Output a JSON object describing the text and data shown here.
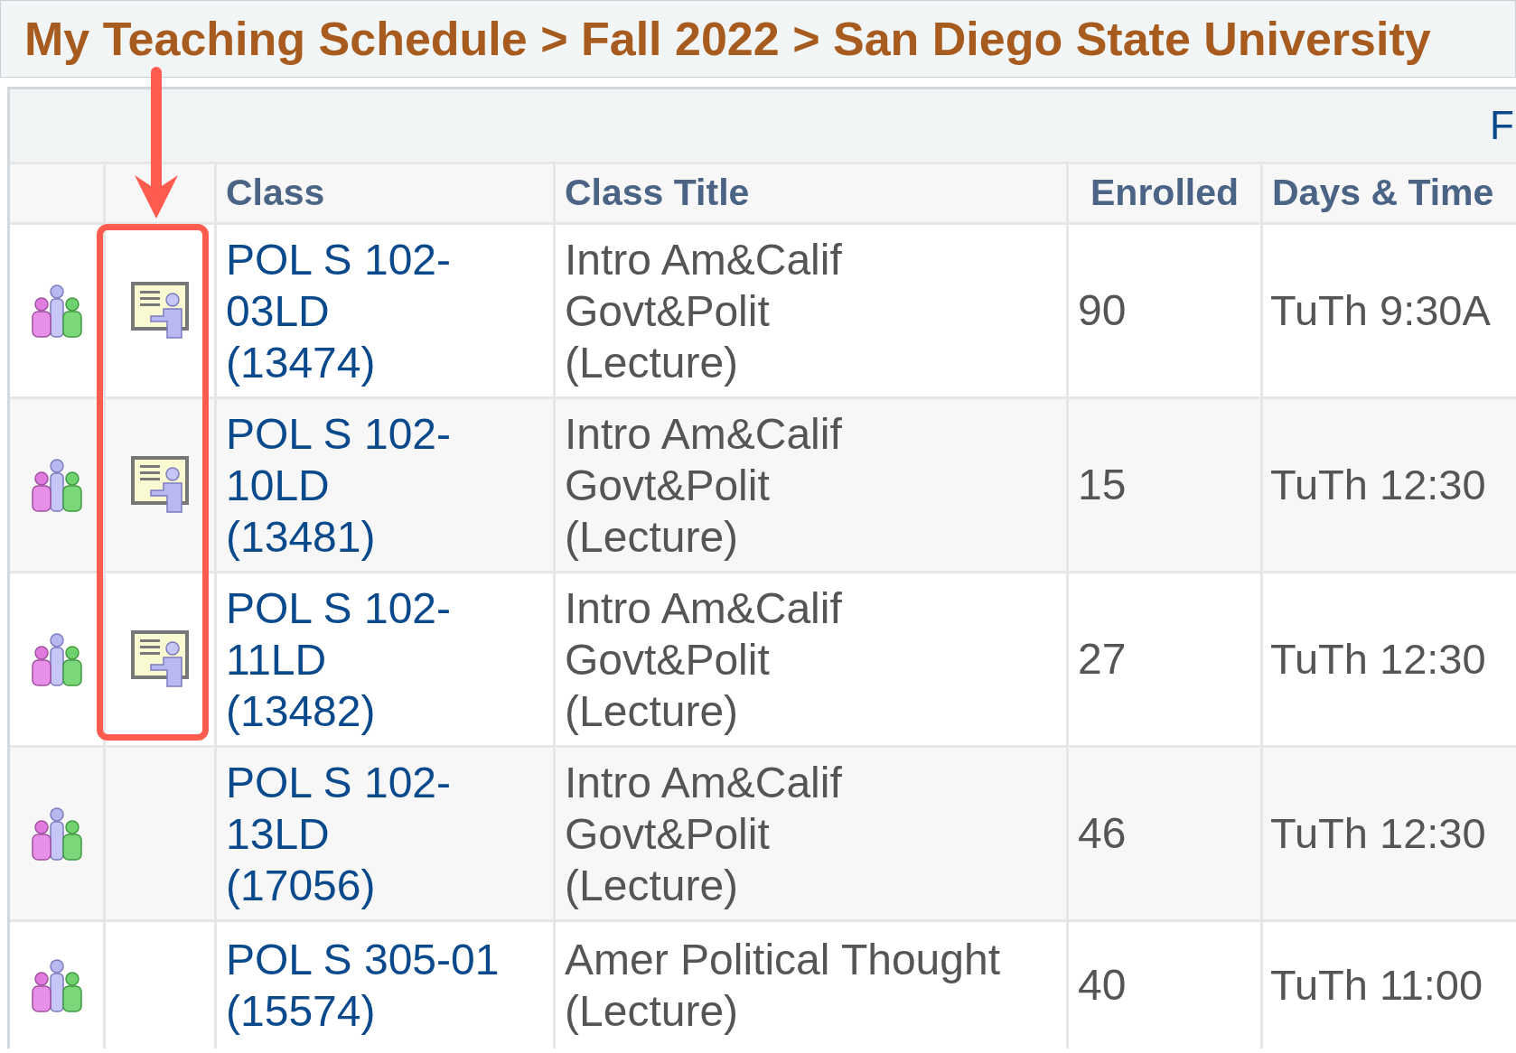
{
  "title": "My Teaching Schedule > Fall 2022 > San Diego State University",
  "toolbar": {
    "link": "F"
  },
  "table": {
    "columns": [
      "Class",
      "Class Title",
      "Enrolled",
      "Days & Time"
    ],
    "rows": [
      {
        "class": "POL S 102-03LD",
        "class_number": "(13474)",
        "title": "Intro Am&Calif Govt&Polit",
        "component": "(Lecture)",
        "enrolled": "90",
        "days_times": "TuTh 9:30A",
        "teaching_icon": true
      },
      {
        "class": "POL S 102-10LD",
        "class_number": "(13481)",
        "title": "Intro Am&Calif Govt&Polit",
        "component": "(Lecture)",
        "enrolled": "15",
        "days_times": "TuTh 12:30",
        "teaching_icon": true
      },
      {
        "class": "POL S 102-11LD",
        "class_number": "(13482)",
        "title": "Intro Am&Calif Govt&Polit",
        "component": "(Lecture)",
        "enrolled": "27",
        "days_times": "TuTh 12:30",
        "teaching_icon": true
      },
      {
        "class": "POL S 102-13LD",
        "class_number": "(17056)",
        "title": "Intro Am&Calif Govt&Polit",
        "component": "(Lecture)",
        "enrolled": "46",
        "days_times": "TuTh 12:30",
        "teaching_icon": false
      },
      {
        "class": "POL S 305-01",
        "class_number": "(15574)",
        "title": "Amer Political Thought",
        "component": "(Lecture)",
        "enrolled": "40",
        "days_times": "TuTh 11:00",
        "teaching_icon": false
      }
    ]
  },
  "annotation": {
    "kind": "arrow-box"
  }
}
